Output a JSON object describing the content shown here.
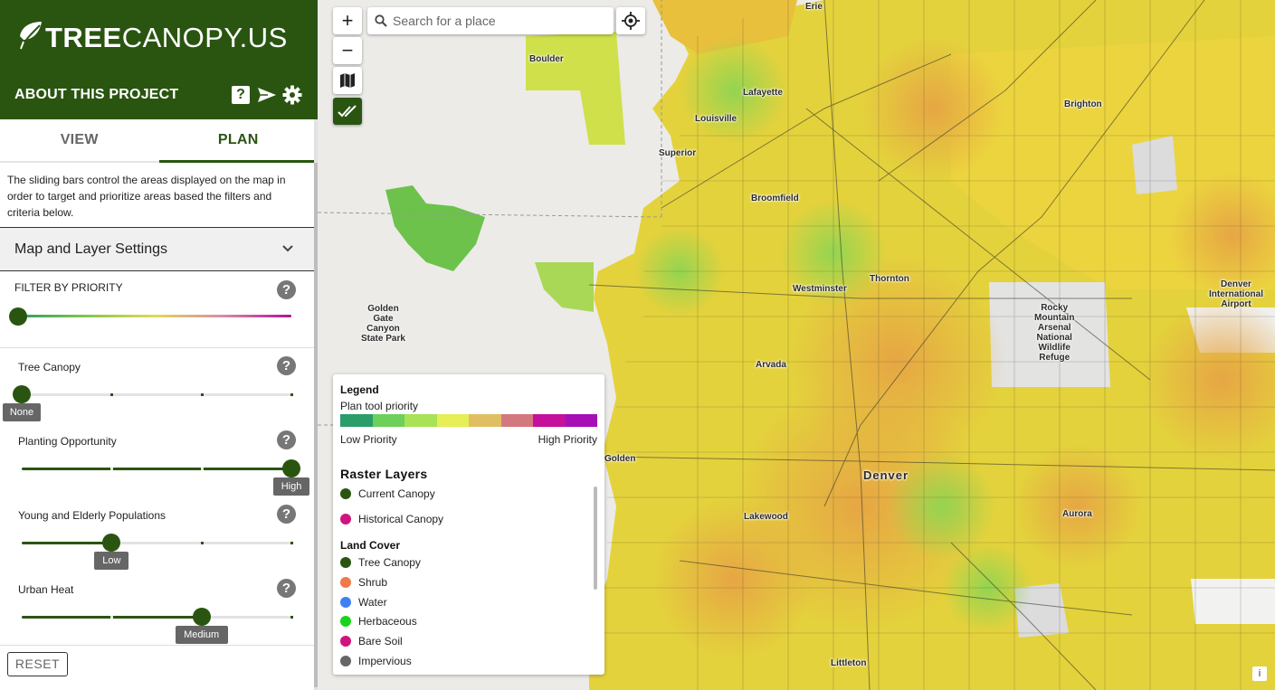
{
  "brand": {
    "logo_bold": "TREE",
    "logo_regular": "CANOPY.US",
    "about_title": "ABOUT THIS PROJECT",
    "help_icon_glyph": "?",
    "icons": [
      "leaf-icon",
      "help-icon",
      "send-icon",
      "gear-icon"
    ],
    "color": "#2a5511"
  },
  "tabs": [
    {
      "label": "VIEW",
      "active": false
    },
    {
      "label": "PLAN",
      "active": true
    }
  ],
  "intro_text": "The sliding bars control the areas displayed on the map in order to target and prioritize areas based the filters and criteria below.",
  "map_settings_label": "Map and Layer Settings",
  "filter": {
    "label": "FILTER BY PRIORITY",
    "value": 0
  },
  "sliders": [
    {
      "label": "Tree Canopy",
      "value_label": "None",
      "level": 0
    },
    {
      "label": "Planting Opportunity",
      "value_label": "High",
      "level": 3
    },
    {
      "label": "Young and Elderly Populations",
      "value_label": "Low",
      "level": 1
    },
    {
      "label": "Urban Heat",
      "value_label": "Medium",
      "level": 2
    }
  ],
  "help_glyph": "?",
  "reset_label": "RESET",
  "map": {
    "search_placeholder": "Search for a place",
    "zoom_in": "+",
    "zoom_out": "−",
    "attribution": "i",
    "places": {
      "erie": "Erie",
      "boulder": "Boulder",
      "lafayette": "Lafayette",
      "louisville": "Louisville",
      "brighton": "Brighton",
      "superior": "Superior",
      "broomfield": "Broomfield",
      "thornton": "Thornton",
      "westminster": "Westminster",
      "golden_gate": "Golden\nGate\nCanyon\nState Park",
      "rocky_mountain": "Rocky\nMountain\nArsenal\nNational\nWildlife\nRefuge",
      "airport": "Denver\nInternational\nAirport",
      "arvada": "Arvada",
      "golden": "Golden",
      "denver": "Denver",
      "lakewood": "Lakewood",
      "aurora": "Aurora",
      "littleton": "Littleton"
    }
  },
  "legend": {
    "title": "Legend",
    "subtitle": "Plan tool priority",
    "ramp": [
      "#2a9d6a",
      "#6dd05a",
      "#a9e255",
      "#e6ef55",
      "#dfbf62",
      "#d47880",
      "#c4109a",
      "#a60fb5"
    ],
    "low_label": "Low Priority",
    "high_label": "High Priority",
    "raster_title": "Raster Layers",
    "raster_items": [
      {
        "label": "Current Canopy",
        "color": "#2a5511"
      },
      {
        "label": "Historical Canopy",
        "color": "#d0147e"
      }
    ],
    "landcover_title": "Land Cover",
    "landcover_items": [
      {
        "label": "Tree Canopy",
        "color": "#2a5511"
      },
      {
        "label": "Shrub",
        "color": "#f0784a"
      },
      {
        "label": "Water",
        "color": "#3f7ff2"
      },
      {
        "label": "Herbaceous",
        "color": "#18d41a"
      },
      {
        "label": "Bare Soil",
        "color": "#d0147e"
      },
      {
        "label": "Impervious",
        "color": "#666666"
      }
    ]
  }
}
